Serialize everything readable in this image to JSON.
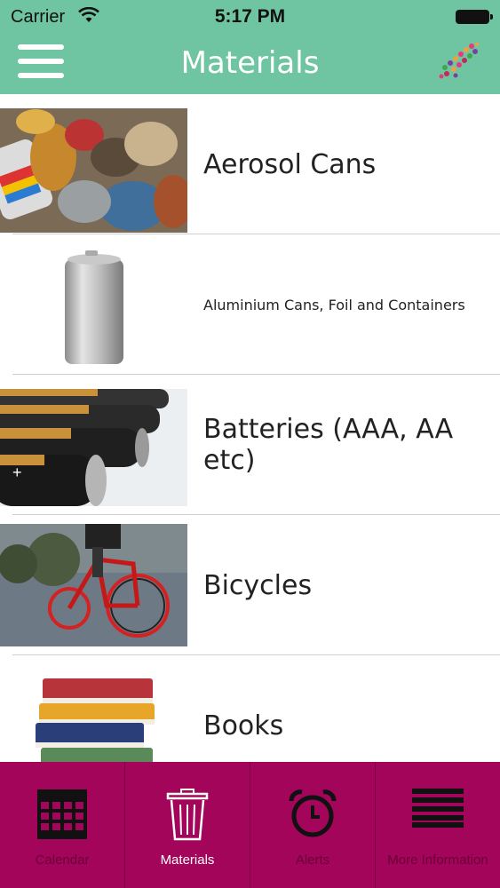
{
  "status_bar": {
    "carrier": "Carrier",
    "time": "5:17 PM"
  },
  "header": {
    "title": "Materials",
    "menu_icon": "hamburger-menu-icon",
    "logo_icon": "app-logo-icon"
  },
  "materials": [
    {
      "label": "Aerosol Cans",
      "image": "aerosol-cans-photo"
    },
    {
      "label": "Aluminium Cans, Foil and Containers",
      "image": "aluminium-can-photo"
    },
    {
      "label": "Batteries (AAA, AA etc)",
      "image": "batteries-photo"
    },
    {
      "label": "Bicycles",
      "image": "bicycle-photo"
    },
    {
      "label": "Books",
      "image": "books-photo"
    }
  ],
  "tabs": [
    {
      "label": "Calendar",
      "icon": "calendar-icon",
      "active": false
    },
    {
      "label": "Materials",
      "icon": "trash-bin-icon",
      "active": true
    },
    {
      "label": "Alerts",
      "icon": "alarm-clock-icon",
      "active": false
    },
    {
      "label": "More Information",
      "icon": "list-lines-icon",
      "active": false
    }
  ],
  "colors": {
    "header": "#6fc5a1",
    "tab_bar": "#a3055b",
    "tab_inactive_text": "#6a0036",
    "tab_active_text": "#ffffff"
  }
}
